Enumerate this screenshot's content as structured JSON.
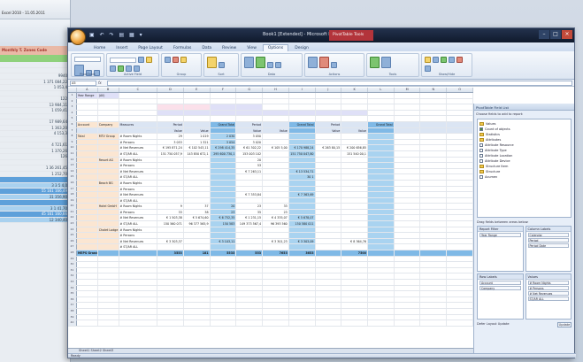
{
  "bg_window": {
    "title": "Excel 2010 - 11.05.2011",
    "banner": "Monthly T. Zones Code",
    "rows": [
      "",
      "",
      "9940",
      "1 371 084,22",
      "1 053,4",
      "",
      "122",
      "13 984,11",
      "1 059,41",
      "",
      "17 989,64",
      "1 363,20",
      "4 153,3",
      "",
      "4 721,61",
      "1 370,26",
      "126",
      "",
      "1 36 261,45",
      "1 252,70",
      "",
      "3 3 5 4,0",
      "55 161 166,49",
      "31 356,90",
      "",
      "3 1 41,70",
      "45 161 160,66",
      "12 340,40"
    ]
  },
  "window": {
    "title": "Book1 [Extended] - Microsoft Excel",
    "context_tab": "PivotTable Tools",
    "tabs": [
      "Home",
      "Insert",
      "Page Layout",
      "Formulas",
      "Data",
      "Review",
      "View",
      "Options",
      "Design"
    ],
    "active_tab": "Options",
    "ribbon_groups": [
      "PivotTable",
      "Active Field",
      "Group",
      "Sort",
      "Data",
      "Actions",
      "Tools",
      "Show/Hide"
    ],
    "namebox": "A5",
    "formula": ""
  },
  "columns": [
    "A",
    "B",
    "C",
    "D",
    "E",
    "F",
    "G",
    "H",
    "I",
    "J",
    "K",
    "L",
    "M",
    "N",
    "O"
  ],
  "grid": {
    "filter_label": "Year Range",
    "filter_value": "(All)",
    "header_row": [
      "Account",
      "Company",
      "Measures",
      "Period",
      "",
      "Grand Total",
      "Period",
      "",
      "Grand Total",
      "Period",
      "",
      "Grand Total"
    ],
    "groups": [
      {
        "account": "Total",
        "company": "MTV Group",
        "rows": [
          [
            "# Room Nights",
            "29",
            "1 019",
            "2 030",
            "3 050",
            "",
            "",
            "",
            ""
          ],
          [
            "# Persons",
            "3 053",
            "1 321",
            "3 054",
            "3 020",
            "",
            "",
            "",
            ""
          ],
          [
            "# Net Revenues",
            "€ 195 871,24",
            "€ 102 543,11",
            "€ 298 414,35",
            "€ 61 302,22",
            "€ 105 5,00",
            "€ 170 988,24",
            "€ 263 80,15",
            "€ 200 656,85"
          ],
          [
            "# ST/AR ALL",
            "151 750 057,9",
            "143 850 672,1",
            "295 600 730,1",
            "153 003 102",
            "",
            "151 750 047,80",
            "",
            "151 540 00,1"
          ]
        ]
      },
      {
        "account": "",
        "company": "Resort AG",
        "rows": [
          [
            "# Room Nights",
            "",
            "",
            "",
            "20",
            "",
            "",
            "",
            ""
          ],
          [
            "# Persons",
            "",
            "",
            "",
            "53",
            "",
            "",
            "",
            ""
          ],
          [
            "# Net Revenues",
            "",
            "",
            "",
            "€ 7 263,11",
            "",
            "€ 13 534,71",
            "",
            ""
          ],
          [
            "# ST/AR ALL",
            "",
            "",
            "",
            "",
            "",
            "30 1",
            "",
            ""
          ]
        ]
      },
      {
        "account": "",
        "company": "Beach BG",
        "rows": [
          [
            "# Room Nights",
            "",
            "",
            "",
            "",
            "",
            "",
            "",
            ""
          ],
          [
            "# Persons",
            "",
            "",
            "",
            "",
            "",
            "",
            "",
            ""
          ],
          [
            "# Net Revenues",
            "",
            "",
            "",
            "€ 7 353,84",
            "",
            "€ 7 363,69",
            "",
            ""
          ],
          [
            "# ST/AR ALL",
            "",
            "",
            "",
            "",
            "",
            "",
            "",
            ""
          ]
        ]
      },
      {
        "account": "",
        "company": "Hotel GmbH",
        "rows": [
          [
            "# Room Nights",
            "9",
            "37",
            "20",
            "23",
            "33",
            "",
            "",
            ""
          ],
          [
            "# Persons",
            "33",
            "38",
            "23",
            "35",
            "23",
            "",
            "",
            ""
          ],
          [
            "# Net Revenues",
            "€ 1 503,38",
            "€ 5 674,60",
            "€ 6 752,35",
            "€ 1 231,15",
            "€ 4 335,07",
            "€ 5 678,07",
            "",
            ""
          ],
          [
            "# ST/AR ALL",
            "150 560 071",
            "96 377 565,9",
            "150 583",
            "149 373 567,4",
            "96 393 560",
            "150 580 011",
            "",
            ""
          ]
        ]
      },
      {
        "account": "",
        "company": "Chalet Lodge",
        "rows": [
          [
            "# Room Nights",
            "",
            "",
            "",
            "",
            "",
            "",
            "",
            ""
          ],
          [
            "# Persons",
            "",
            "",
            "",
            "",
            "",
            "",
            "",
            ""
          ],
          [
            "# Net Revenues",
            "€ 3 303,37",
            "",
            "€ 3 103,11",
            "",
            "€ 3 301,23",
            "€ 3 303,09",
            "",
            "€ 8 364,76"
          ],
          [
            "# ST/AR ALL",
            "",
            "",
            "",
            "",
            "",
            "",
            "",
            ""
          ]
        ]
      }
    ],
    "total_row": [
      "MEPS Grand Total",
      "3553",
      "181",
      "5533",
      "553",
      "7653",
      "3653",
      "",
      "7500"
    ]
  },
  "sheet_tabs": [
    "Sheet1",
    "Sheet2",
    "Sheet3"
  ],
  "status": "Ready",
  "pivot": {
    "title": "PivotTable Field List",
    "subtitle": "Choose fields to add to report:",
    "show": "Show fields",
    "fields": [
      {
        "label": "Values",
        "checked": false,
        "folder": true
      },
      {
        "label": "Count of objects",
        "checked": true,
        "folder": false
      },
      {
        "label": "Statistics",
        "checked": false,
        "folder": true
      },
      {
        "label": "Attributes",
        "checked": false,
        "folder": true
      },
      {
        "label": "Attribute Resource",
        "checked": false,
        "folder": false
      },
      {
        "label": "Attribute Type",
        "checked": false,
        "folder": false
      },
      {
        "label": "Attribute Location",
        "checked": false,
        "folder": false
      },
      {
        "label": "Attribute Device",
        "checked": false,
        "folder": false
      },
      {
        "label": "Structure Item",
        "checked": false,
        "folder": true
      },
      {
        "label": "Structure",
        "checked": false,
        "folder": true
      },
      {
        "label": "Acumen",
        "checked": false,
        "folder": false
      }
    ],
    "drag_label": "Drag fields between areas below:",
    "zones": [
      {
        "title": "Report Filter",
        "items": [
          "Year Range"
        ]
      },
      {
        "title": "Column Labels",
        "items": [
          "Calendar",
          "Period",
          "Period Date"
        ]
      },
      {
        "title": "Row Labels",
        "items": [
          "Account",
          "Company"
        ]
      },
      {
        "title": "Values",
        "items": [
          "# Room Nights",
          "# Persons",
          "# Net Revenues",
          "ST/AR ALL"
        ]
      }
    ],
    "defer_label": "Defer Layout Update",
    "update_label": "Update"
  }
}
